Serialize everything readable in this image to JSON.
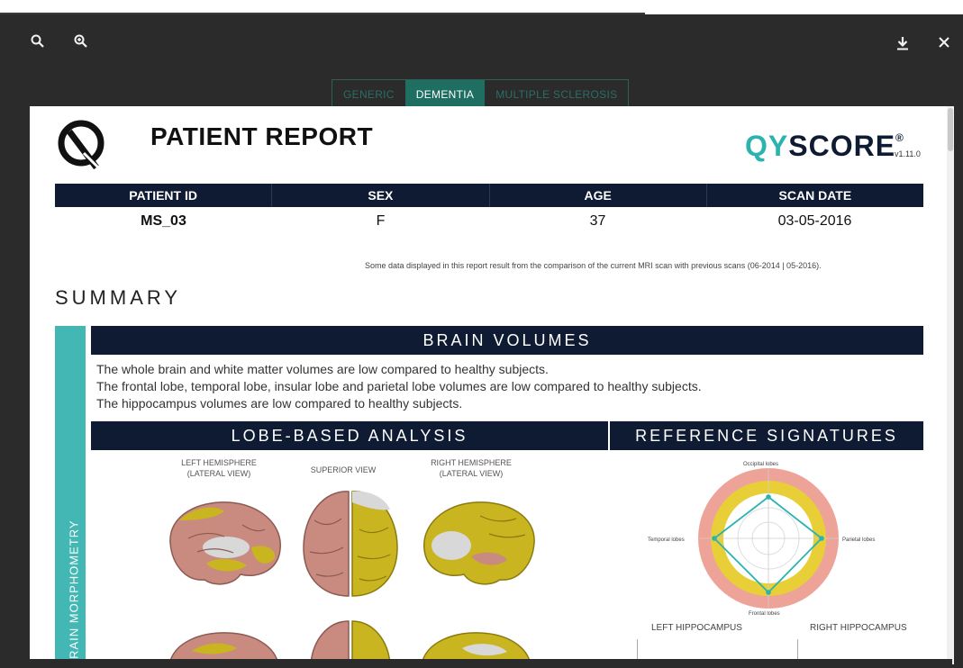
{
  "toolbar": {
    "zoom_out_icon": "zoom-out-icon",
    "zoom_in_icon": "zoom-in-icon",
    "download_icon": "download-icon",
    "close_icon": "close-icon"
  },
  "tabs": [
    {
      "label": "GENERIC",
      "active": false
    },
    {
      "label": "DEMENTIA",
      "active": true
    },
    {
      "label": "MULTIPLE SCLEROSIS",
      "active": false
    }
  ],
  "report": {
    "title": "PATIENT REPORT",
    "brand_q": "QY",
    "brand_rest": "SCORE",
    "brand_mark": "®",
    "version": "v1.11.0",
    "columns": [
      "PATIENT ID",
      "SEX",
      "AGE",
      "SCAN DATE"
    ],
    "values": [
      "MS_03",
      "F",
      "37",
      "03-05-2016"
    ],
    "note": "Some data displayed in this report result from the comparison of the current MRI scan with previous scans (06-2014 | 05-2016).",
    "summary": "SUMMARY",
    "sidebar_label": "BRAIN MORPHOMETRY",
    "brain_volumes": {
      "heading": "BRAIN VOLUMES",
      "lines": [
        "The whole brain and white matter volumes are low compared to healthy subjects.",
        "The frontal lobe, temporal lobe, insular lobe and parietal lobe volumes are low compared to healthy subjects.",
        "The hippocampus volumes are low compared to healthy subjects."
      ]
    },
    "lobe_heading": "LOBE-BASED ANALYSIS",
    "ref_heading": "REFERENCE SIGNATURES",
    "views": {
      "left": "LEFT HEMISPHERE\n(LATERAL VIEW)",
      "superior": "SUPERIOR VIEW",
      "right": "RIGHT HEMISPHERE\n(LATERAL VIEW)"
    },
    "radar": {
      "top": "Occipital lobes",
      "left": "Temporal lobes",
      "right": "Parietal lobes",
      "bottom": "Frontal lobes"
    },
    "hippocampus": {
      "left": "LEFT HIPPOCAMPUS",
      "right": "RIGHT HIPPOCAMPUS"
    }
  },
  "colors": {
    "viewer_bg": "#2b2b2b",
    "accent_tab": "#1e6e62",
    "navy": "#0f1b33",
    "teal": "#42b7b4",
    "brain_pink": "#c98a80",
    "brain_yellow": "#c9b520"
  }
}
